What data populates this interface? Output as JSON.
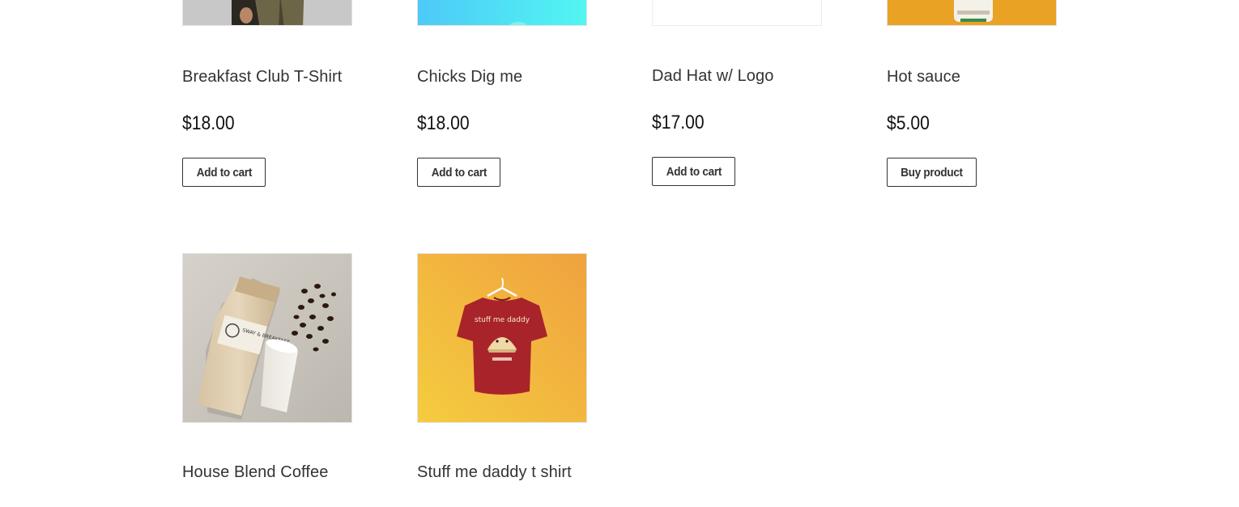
{
  "products": [
    {
      "title": "Breakfast Club T-Shirt",
      "price": "$18.00",
      "button": "Add to cart"
    },
    {
      "title": "Chicks Dig me",
      "price": "$18.00",
      "button": "Add to cart"
    },
    {
      "title": "Dad Hat w/ Logo",
      "price": "$17.00",
      "button": "Add to cart"
    },
    {
      "title": "Hot sauce",
      "price": "$5.00",
      "button": "Buy product"
    },
    {
      "title": "House Blend Coffee"
    },
    {
      "title": "Stuff me daddy t shirt"
    }
  ],
  "images": {
    "coffee_bag_label": "SWAY & BREAKFAST",
    "shirt_print_text": "stuff me daddy"
  },
  "colors": {
    "text": "#333333",
    "price": "#111111",
    "button_border": "#333333",
    "cyan_image": "#4ee8f8",
    "orange_image": "#e9a224",
    "shirt_red": "#a8242a"
  }
}
